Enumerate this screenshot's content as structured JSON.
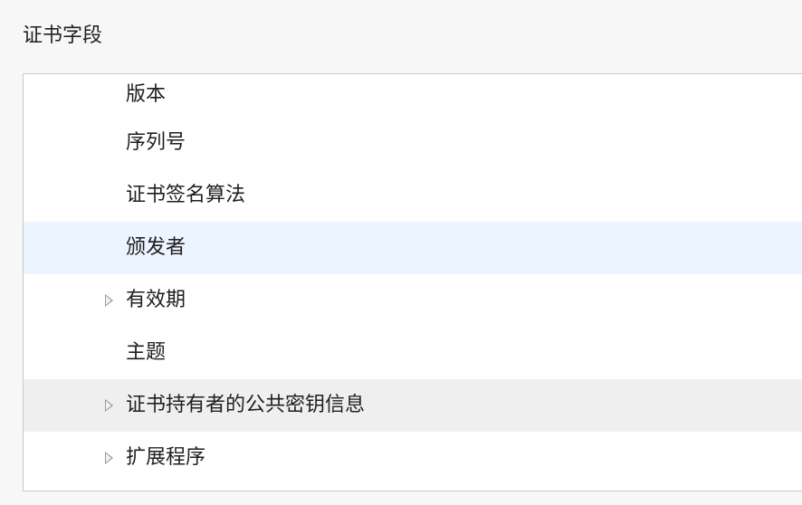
{
  "section": {
    "title": "证书字段"
  },
  "tree": {
    "items": [
      {
        "label": "版本",
        "expandable": false,
        "state": "normal"
      },
      {
        "label": "序列号",
        "expandable": false,
        "state": "normal"
      },
      {
        "label": "证书签名算法",
        "expandable": false,
        "state": "normal"
      },
      {
        "label": "颁发者",
        "expandable": false,
        "state": "selected"
      },
      {
        "label": "有效期",
        "expandable": true,
        "state": "normal"
      },
      {
        "label": "主题",
        "expandable": false,
        "state": "normal"
      },
      {
        "label": "证书持有者的公共密钥信息",
        "expandable": true,
        "state": "hovered"
      },
      {
        "label": "扩展程序",
        "expandable": true,
        "state": "normal"
      }
    ]
  },
  "icons": {
    "disclosure": "disclosure-triangle-right-icon"
  },
  "colors": {
    "selected_row": "#ecf4ff",
    "hovered_row": "#efefef",
    "disclosure_triangle": "#9a9a9a"
  }
}
